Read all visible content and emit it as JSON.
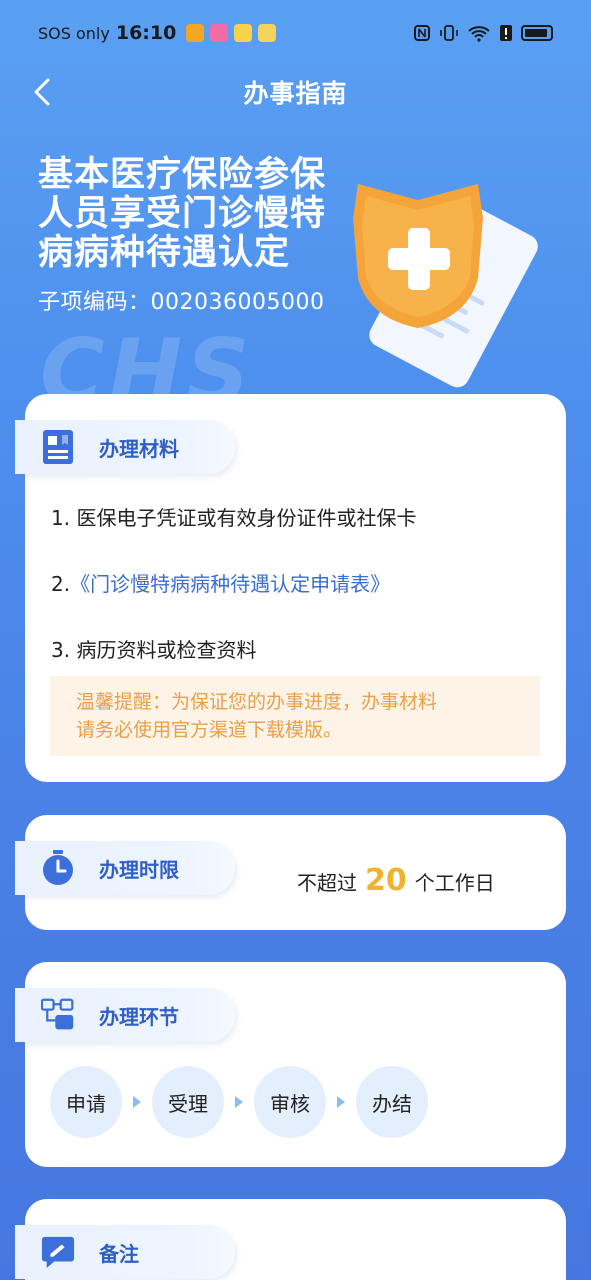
{
  "status_bar": {
    "carrier": "SOS only",
    "time": "16:10"
  },
  "nav": {
    "title": "办事指南"
  },
  "hero": {
    "title_lines": [
      "基本医疗保险参保",
      "人员享受门诊慢特",
      "病病种待遇认定"
    ],
    "code_label": "子项编码：",
    "code_value": "002036005000",
    "watermark": "CHS"
  },
  "materials": {
    "label": "办理材料",
    "items": [
      "1. 医保电子凭证或有效身份证件或社保卡",
      "2.",
      "3. 病历资料或检查资料"
    ],
    "link_text": "《门诊慢特病病种待遇认定申请表》",
    "tip_line1": "温馨提醒：为保证您的办事进度，办事材料",
    "tip_line2": "请务必使用官方渠道下载模版。"
  },
  "time_limit": {
    "label": "办理时限",
    "prefix": "不超过",
    "days": "20",
    "suffix": "个工作日"
  },
  "process": {
    "label": "办理环节",
    "steps": [
      "申请",
      "受理",
      "审核",
      "办结"
    ]
  },
  "remarks": {
    "label": "备注"
  },
  "colors": {
    "accent": "#2f5fc4",
    "link": "#3a6ed4",
    "highlight": "#f0b32b",
    "tip_text": "#e8a04c"
  }
}
